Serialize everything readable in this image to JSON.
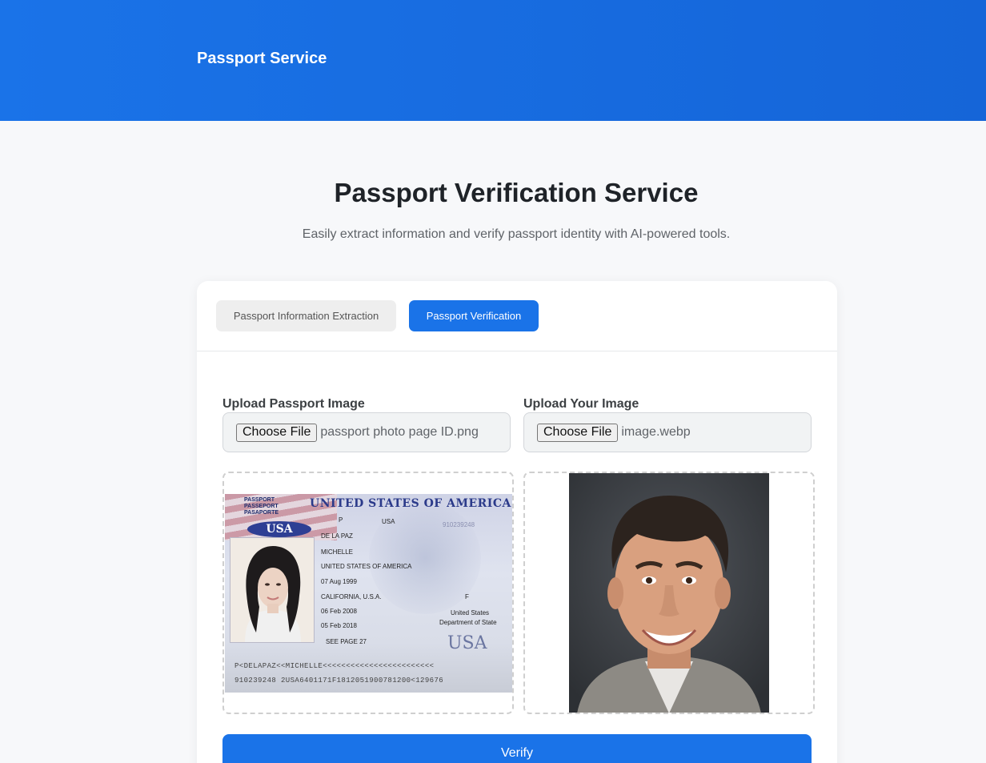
{
  "header": {
    "brand": "Passport Service"
  },
  "hero": {
    "title": "Passport Verification Service",
    "subtitle": "Easily extract information and verify passport identity with AI-powered tools."
  },
  "tabs": [
    {
      "label": "Passport Information Extraction",
      "active": false
    },
    {
      "label": "Passport Verification",
      "active": true
    }
  ],
  "uploads": {
    "passport": {
      "label": "Upload Passport Image",
      "button": "Choose File",
      "filename": "passport photo page ID.png"
    },
    "selfie": {
      "label": "Upload Your Image",
      "button": "Choose File",
      "filename": "image.webp"
    }
  },
  "passport_preview": {
    "kind": [
      "PASSPORT",
      "PASSEPORT",
      "PASAPORTE"
    ],
    "country_header": "UNITED STATES OF AMERICA",
    "badge": "USA",
    "type": "P",
    "code": "USA",
    "passport_no": "910239248",
    "surname": "DE LA PAZ",
    "given_names": "MICHELLE",
    "nationality": "UNITED STATES OF AMERICA",
    "dob": "07 Aug 1999",
    "sex": "F",
    "birthplace": "CALIFORNIA, U.S.A.",
    "issue_date": "06 Feb 2008",
    "expiry_date": "05 Feb 2018",
    "authority": "United States",
    "authority_2": "Department of State",
    "endorsements": "SEE PAGE 27",
    "usa_mark": "USA",
    "mrz_1": "P<DELAPAZ<<MICHELLE<<<<<<<<<<<<<<<<<<<<<<<<",
    "mrz_2": "910239248 2USA6401171F1812051900781200<129676"
  },
  "actions": {
    "verify": "Verify"
  },
  "colors": {
    "primary": "#1a73e8",
    "background": "#f7f8fa"
  }
}
